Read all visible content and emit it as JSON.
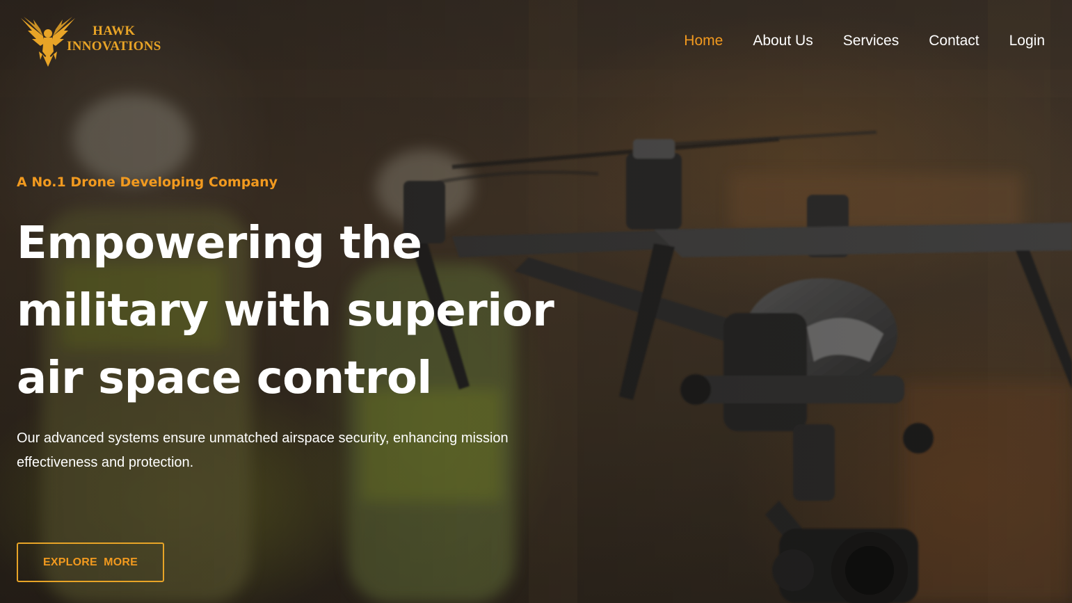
{
  "brand": {
    "name_line1": "HAWK",
    "name_line2": "INNOVATIONS",
    "logo_icon": "hawk-emblem-icon",
    "color": "#e8a427"
  },
  "nav": {
    "items": [
      {
        "label": "Home",
        "active": true
      },
      {
        "label": "About Us",
        "active": false
      },
      {
        "label": "Services",
        "active": false
      },
      {
        "label": "Contact",
        "active": false
      },
      {
        "label": "Login",
        "active": false
      }
    ],
    "active_color": "#f29a1f",
    "text_color": "#ffffff"
  },
  "hero": {
    "eyebrow": "A No.1 Drone Developing Company",
    "headline_lines": [
      "Empowering the",
      "military with superior",
      "air space control"
    ],
    "description": "Our advanced systems ensure unmatched airspace security, enhancing mission effectiveness and protection.",
    "cta_label": "EXPLORE  MORE",
    "background_image": "drone-hovering-near-workers-photo"
  },
  "colors": {
    "accent": "#f29a1f",
    "headline": "#ffffff",
    "overlay": "#1e1812"
  }
}
